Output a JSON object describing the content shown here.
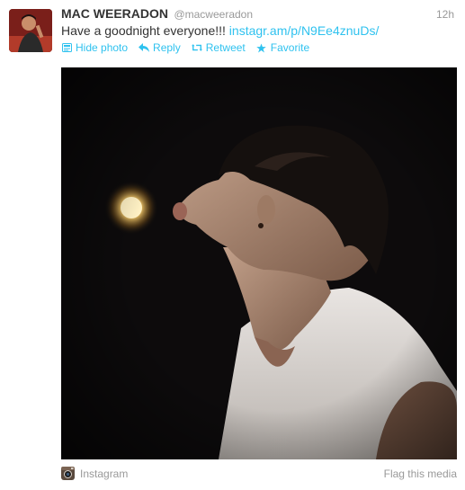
{
  "tweet": {
    "fullname": "MAC WEERADON",
    "screenname": "@macweeradon",
    "timestamp": "12h",
    "text": "Have a goodnight everyone!!!",
    "link": "instagr.am/p/N9Ee4znuDs/"
  },
  "actions": {
    "hide_photo": "Hide photo",
    "reply": "Reply",
    "retweet": "Retweet",
    "favorite": "Favorite"
  },
  "media_footer": {
    "provider": "Instagram",
    "flag": "Flag this media"
  },
  "colors": {
    "link": "#2fc2ef",
    "muted": "#999999",
    "text": "#333333"
  },
  "icons": {
    "hide_photo": "photo-icon",
    "reply": "reply-arrow-icon",
    "retweet": "retweet-icon",
    "favorite": "star-icon",
    "provider": "instagram-camera-icon"
  }
}
